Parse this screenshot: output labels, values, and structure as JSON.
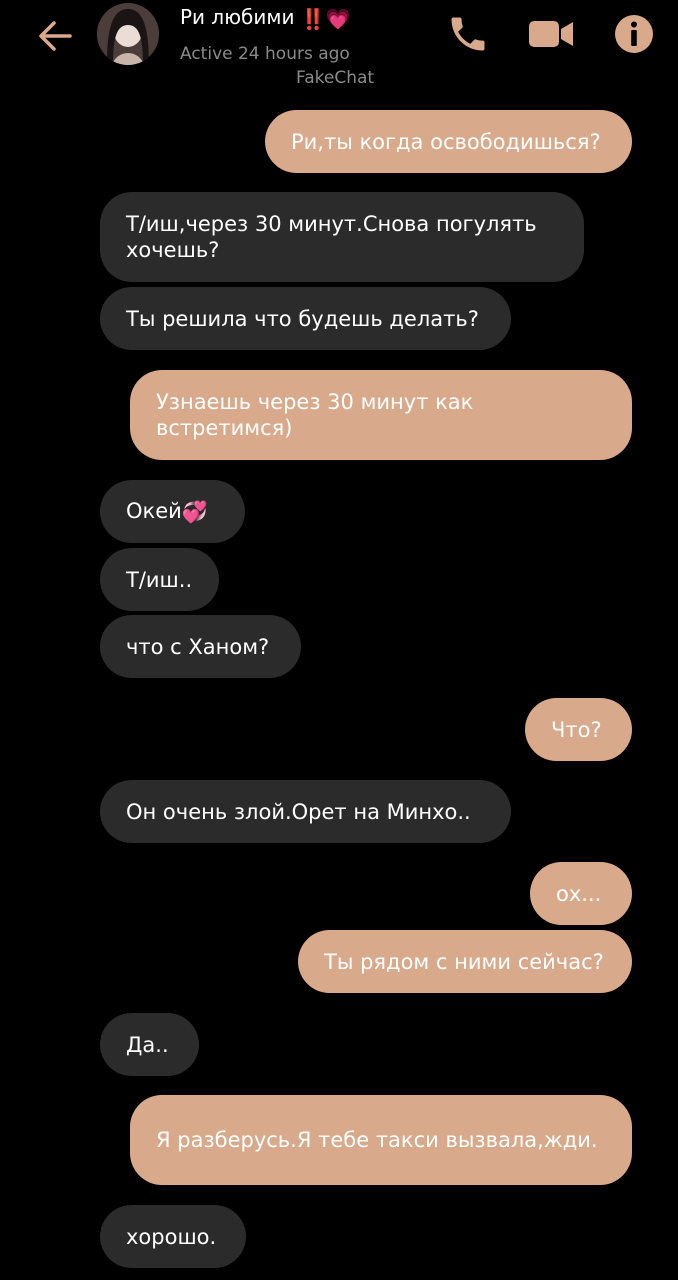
{
  "header": {
    "contact_name": "Ри любими",
    "contact_emoji": "‼️💗",
    "status": "Active 24 hours ago",
    "app_label": "FakeChat",
    "icons": [
      "back-arrow-icon",
      "phone-icon",
      "video-camera-icon",
      "info-icon"
    ],
    "accent_color": "#d8a98a"
  },
  "colors": {
    "incoming_bubble": "#2b2b2b",
    "outgoing_bubble": "#d8a98a",
    "background": "#000000"
  },
  "messages": [
    {
      "from": "me",
      "text": "Ри,ты когда освободишься?"
    },
    {
      "from": "them",
      "text": "Т/иш,через 30 минут.Снова погулять хочешь?"
    },
    {
      "from": "them",
      "text": "Ты решила что будешь делать?"
    },
    {
      "from": "me",
      "text": "Узнаешь через 30 минут как встретимся)"
    },
    {
      "from": "them",
      "text": "Окей",
      "emoji": "💞"
    },
    {
      "from": "them",
      "text": "Т/иш.."
    },
    {
      "from": "them",
      "text": "что с Ханом?"
    },
    {
      "from": "me",
      "text": "Что?"
    },
    {
      "from": "them",
      "text": "Он очень злой.Орет на Минхо.."
    },
    {
      "from": "me",
      "text": "ох..."
    },
    {
      "from": "me",
      "text": "Ты рядом с ними сейчас?"
    },
    {
      "from": "them",
      "text": "Да.."
    },
    {
      "from": "me",
      "text": "Я разберусь.Я тебе такси вызвала,жди."
    },
    {
      "from": "them",
      "text": "хорошо."
    }
  ]
}
